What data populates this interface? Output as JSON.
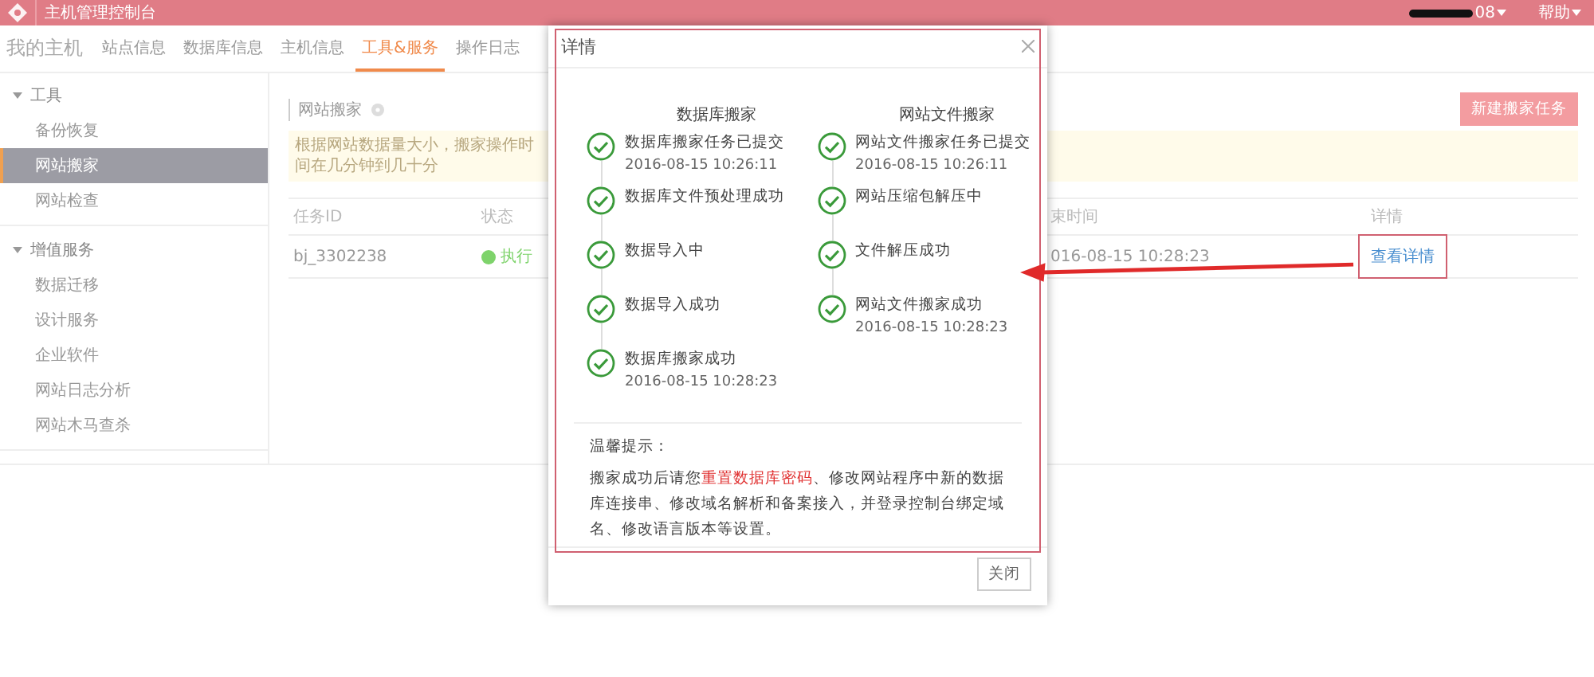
{
  "topbar": {
    "title": "主机管理控制台",
    "account": "08",
    "help": "帮助"
  },
  "nav": {
    "brand": "我的主机",
    "tabs": [
      {
        "label": "站点信息",
        "selected": false
      },
      {
        "label": "数据库信息",
        "selected": false
      },
      {
        "label": "主机信息",
        "selected": false
      },
      {
        "label": "工具&服务",
        "selected": true
      },
      {
        "label": "操作日志",
        "selected": false
      }
    ]
  },
  "sidebar": {
    "groups": [
      {
        "label": "工具",
        "expanded": true,
        "items": [
          {
            "label": "备份恢复",
            "selected": false
          },
          {
            "label": "网站搬家",
            "selected": true
          },
          {
            "label": "网站检查",
            "selected": false
          }
        ]
      },
      {
        "label": "增值服务",
        "expanded": true,
        "items": [
          {
            "label": "数据迁移",
            "selected": false
          },
          {
            "label": "设计服务",
            "selected": false
          },
          {
            "label": "企业软件",
            "selected": false
          },
          {
            "label": "网站日志分析",
            "selected": false
          },
          {
            "label": "网站木马查杀",
            "selected": false
          }
        ]
      }
    ]
  },
  "main": {
    "section_title": "网站搬家",
    "new_button": "新建搬家任务",
    "notice": "根据网站数据量大小，搬家操作时间在几分钟到几十分",
    "table": {
      "columns": [
        "任务ID",
        "状态",
        "束时间",
        "详情"
      ],
      "rows": [
        {
          "task_id": "bj_3302238",
          "status": "执行",
          "color": "#7ed36b",
          "end_time": "016-08-15 10:28:23",
          "detail_link": "查看详情"
        }
      ]
    }
  },
  "dialog": {
    "title": "详情",
    "columns": [
      {
        "heading": "数据库搬家",
        "steps": [
          {
            "text": "数据库搬家任务已提交",
            "time": "2016-08-15 10:26:11",
            "done": true
          },
          {
            "text": "数据库文件预处理成功",
            "done": true
          },
          {
            "text": "数据导入中",
            "done": true
          },
          {
            "text": "数据导入成功",
            "done": true
          },
          {
            "text": "数据库搬家成功",
            "time": "2016-08-15 10:28:23",
            "done": true
          }
        ]
      },
      {
        "heading": "网站文件搬家",
        "steps": [
          {
            "text": "网站文件搬家任务已提交",
            "time": "2016-08-15 10:26:11",
            "done": true
          },
          {
            "text": "网站压缩包解压中",
            "done": true
          },
          {
            "text": "文件解压成功",
            "done": true
          },
          {
            "text": "网站文件搬家成功",
            "time": "2016-08-15 10:28:23",
            "done": true
          }
        ]
      }
    ],
    "tip_title": "温馨提示：",
    "tip_parts": [
      {
        "text": "搬家成功后请您",
        "highlight": false
      },
      {
        "text": "重置数据库密码",
        "highlight": true
      },
      {
        "text": "、修改网站程序中新的数据库连接串、修改域名解析和备案接入，并登录控制台绑定域名、修改语言版本等设置。",
        "highlight": false
      }
    ],
    "close_button": "关闭"
  }
}
